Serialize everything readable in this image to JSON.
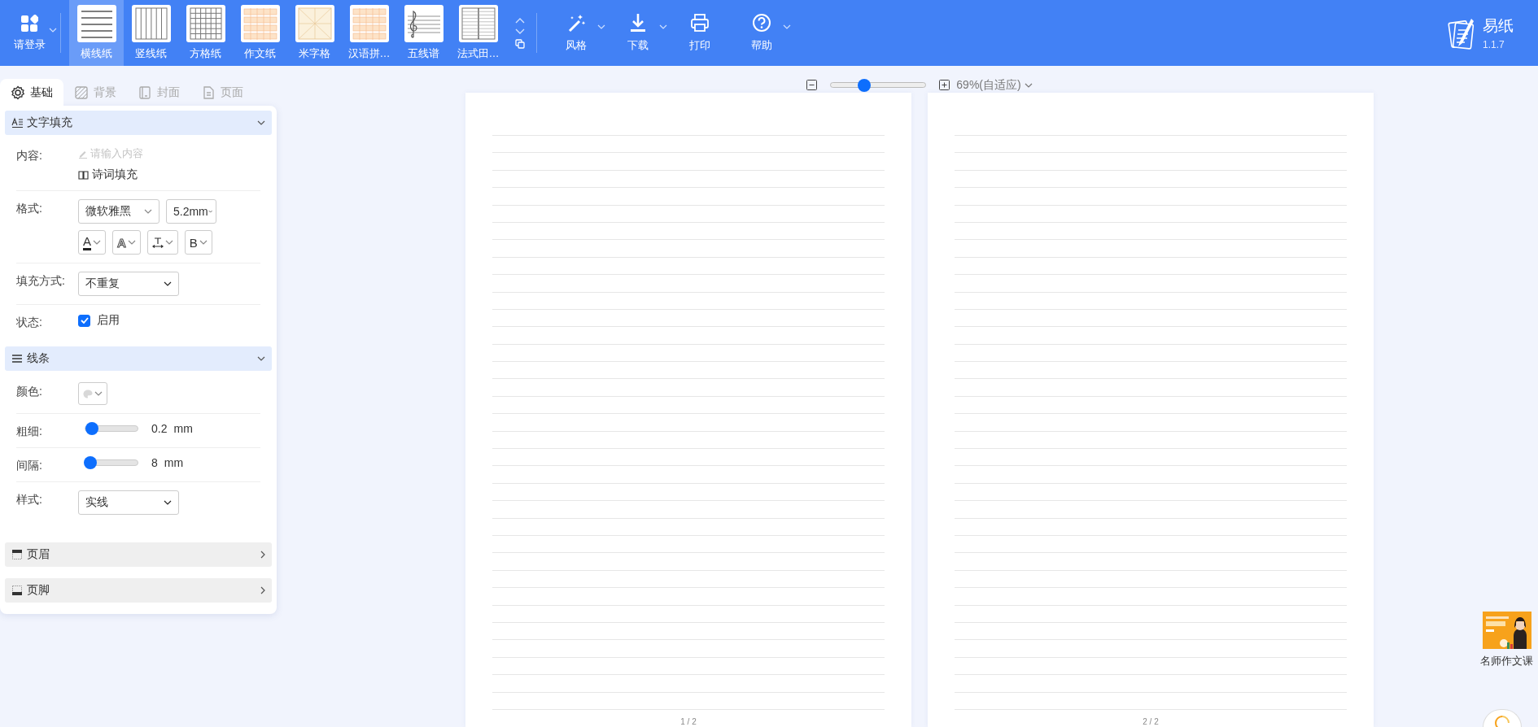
{
  "toolbar": {
    "login": {
      "label": "请登录"
    },
    "paper_types": [
      {
        "label": "横线纸",
        "kind": "lined",
        "selected": true
      },
      {
        "label": "竖线纸",
        "kind": "vertical",
        "selected": false
      },
      {
        "label": "方格纸",
        "kind": "grid",
        "selected": false
      },
      {
        "label": "作文纸",
        "kind": "essay",
        "selected": false
      },
      {
        "label": "米字格",
        "kind": "mi",
        "selected": false
      },
      {
        "label": "汉语拼…",
        "kind": "pinyin",
        "selected": false
      },
      {
        "label": "五线谱",
        "kind": "staff",
        "selected": false
      },
      {
        "label": "法式田…",
        "kind": "french",
        "selected": false
      }
    ],
    "tools": [
      {
        "label": "风格",
        "kind": "style",
        "dropdown": true
      },
      {
        "label": "下载",
        "kind": "download",
        "dropdown": true
      },
      {
        "label": "打印",
        "kind": "print",
        "dropdown": false
      },
      {
        "label": "帮助",
        "kind": "help",
        "dropdown": true
      }
    ],
    "app": {
      "name": "易纸",
      "version": "1.1.7"
    }
  },
  "sidebar": {
    "tabs": [
      {
        "label": "基础",
        "kind": "gear",
        "selected": true
      },
      {
        "label": "背景",
        "kind": "hatch",
        "selected": false
      },
      {
        "label": "封面",
        "kind": "cover",
        "selected": false
      },
      {
        "label": "页面",
        "kind": "page",
        "selected": false
      }
    ],
    "sections": [
      {
        "title": "文字填充",
        "kind": "text",
        "expanded": true,
        "rows": [
          {
            "kind": "content",
            "label": "内容:",
            "placeholder": "请输入内容",
            "link": "诗词填充"
          },
          {
            "kind": "format",
            "label": "格式:",
            "font": "微软雅黑",
            "size": "5.2mm",
            "tools": [
              {
                "kind": "color",
                "glyph": "A"
              },
              {
                "kind": "outline",
                "glyph": "A"
              },
              {
                "kind": "spacing"
              },
              {
                "kind": "bold",
                "glyph": "B"
              }
            ]
          },
          {
            "kind": "select",
            "label": "填充方式:",
            "value": "不重复"
          },
          {
            "kind": "checkbox",
            "label": "状态:",
            "text": "启用",
            "checked": true
          }
        ]
      },
      {
        "title": "线条",
        "kind": "lines",
        "expanded": true,
        "rows": [
          {
            "kind": "color",
            "label": "颜色:"
          },
          {
            "kind": "slider",
            "label": "粗细:",
            "level": 0.12,
            "value": "0.2",
            "unit": "mm"
          },
          {
            "kind": "slider",
            "label": "间隔:",
            "level": 0.1,
            "value": "8",
            "unit": "mm"
          },
          {
            "kind": "select",
            "label": "样式:",
            "value": "实线"
          }
        ]
      },
      {
        "title": "页眉",
        "kind": "header",
        "expanded": false
      },
      {
        "title": "页脚",
        "kind": "footer",
        "expanded": false
      }
    ]
  },
  "zoom": {
    "level": 0.35,
    "label": "69%(自适应)"
  },
  "pages": [
    {
      "number": "1 / 2"
    },
    {
      "number": "2 / 2"
    }
  ],
  "promo": {
    "label": "名师作文课"
  }
}
